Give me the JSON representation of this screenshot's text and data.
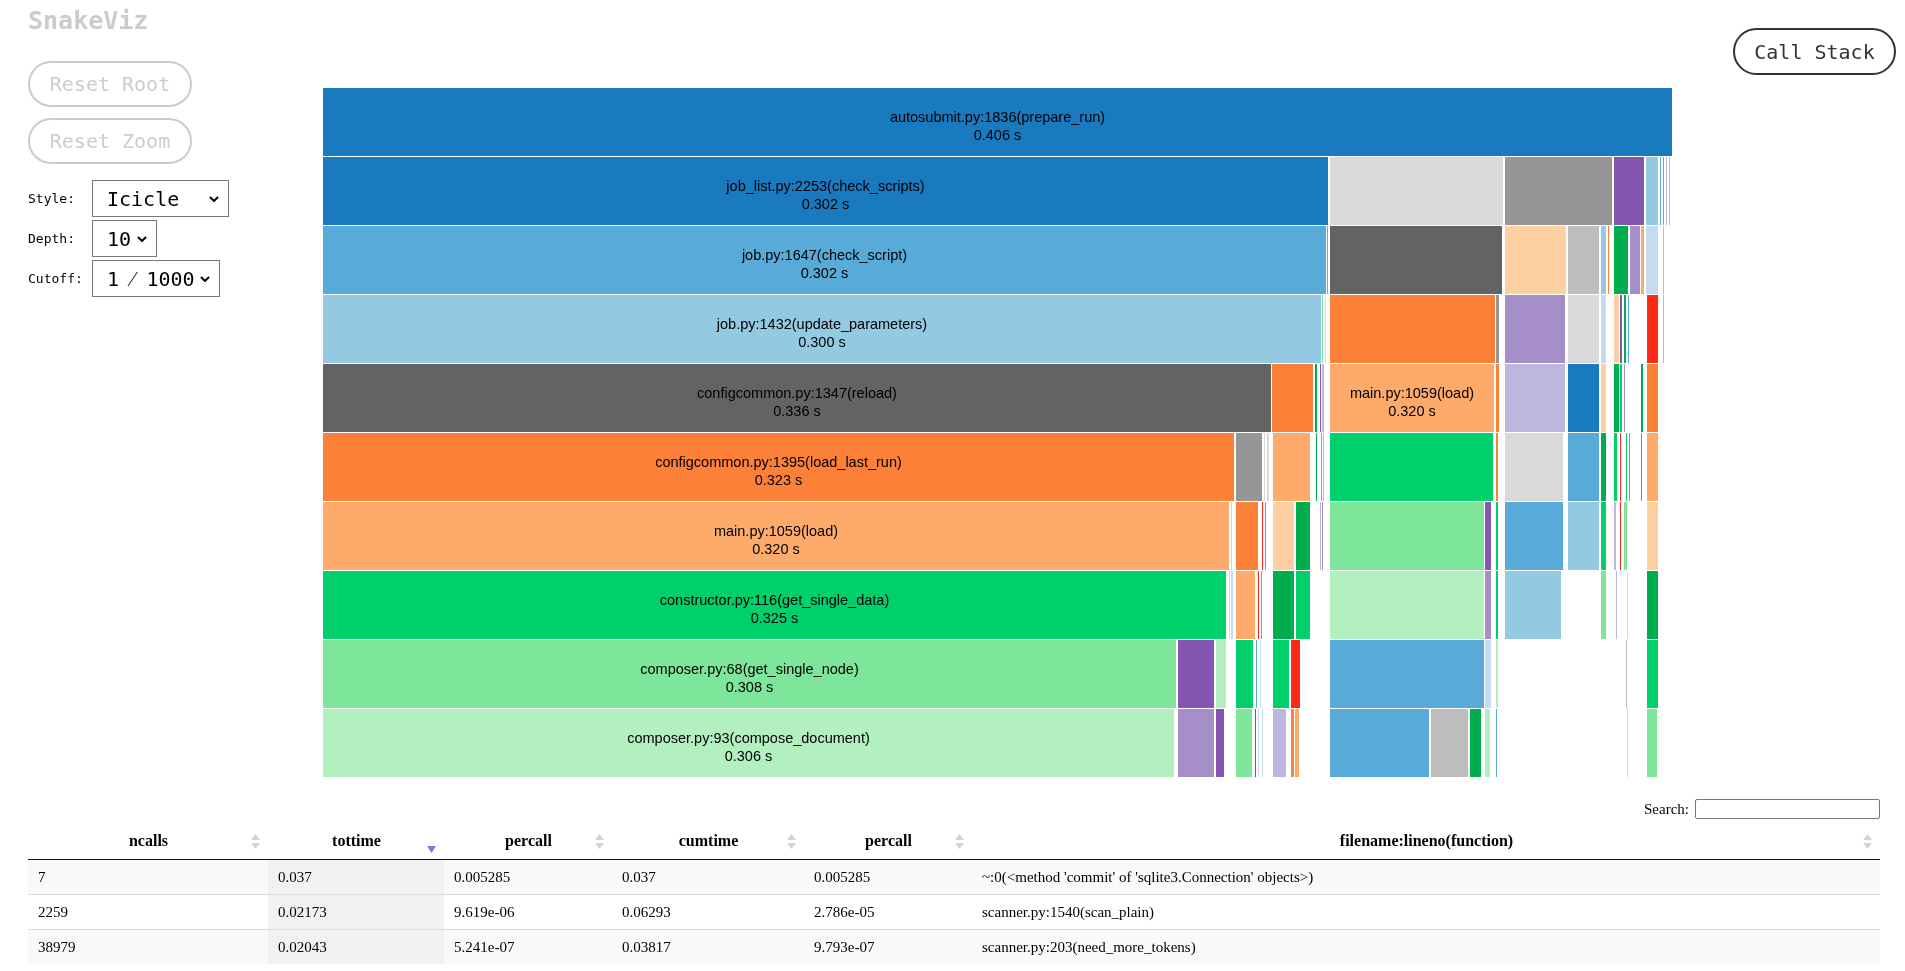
{
  "sidebar": {
    "title": "SnakeViz",
    "buttons": [
      {
        "label": "Reset Root",
        "disabled": true
      },
      {
        "label": "Reset Zoom",
        "disabled": true
      }
    ],
    "options": [
      {
        "label": "Style:",
        "value": "Icicle"
      },
      {
        "label": "Depth:",
        "value": "10"
      },
      {
        "label": "Cutoff:",
        "value": "1 ⁄ 1000"
      }
    ]
  },
  "call_stack_button": {
    "label": "Call Stack",
    "disabled": false
  },
  "icicle": {
    "rows": [
      {
        "blocks": [
          {
            "label": "autosubmit.py:1836(prepare_run)",
            "time": "0.406 s",
            "color": "#1a7abf"
          }
        ]
      },
      {
        "blocks": [
          {
            "label": "job_list.py:2253(check_scripts)",
            "time": "0.302 s",
            "color": "#1a7abf"
          },
          {
            "color": "#d9d9d9"
          },
          {
            "color": "#969696"
          },
          {
            "color": "#8456b2"
          },
          {
            "color": "#93c9e1"
          },
          {
            "color": "#58aad8"
          },
          {
            "color": "#a68fc9"
          },
          {
            "color": "#bfb6dd"
          },
          {
            "color": "#bfb6dd"
          }
        ]
      },
      {
        "blocks": [
          {
            "label": "job.py:1647(check_script)",
            "time": "0.302 s",
            "color": "#58aad8"
          },
          {
            "color": "#fd8039"
          },
          {
            "color": "#636363"
          },
          {
            "color": "#fdd0a2"
          },
          {
            "color": "#bdbdbd"
          },
          {
            "color": "#93c9e1"
          },
          {
            "color": "#fd8039"
          },
          {
            "color": "#00ad4e"
          },
          {
            "color": "#a68fc9"
          },
          {
            "color": "#fdaa6a"
          },
          {
            "color": "#c6dbef"
          },
          {
            "color": "#bfb6dd"
          }
        ]
      },
      {
        "blocks": [
          {
            "label": "job.py:1432(update_parameters)",
            "time": "0.300 s",
            "color": "#93c9e1"
          },
          {
            "color": "#7de69a"
          },
          {
            "color": "#b3f0c0"
          },
          {
            "color": "#fd8039"
          },
          {
            "color": "#969696"
          },
          {
            "color": "#a68fc9"
          },
          {
            "color": "#d9d9d9"
          },
          {
            "color": "#c6dbef"
          },
          {
            "color": "#fdd0a2"
          },
          {
            "color": "#8456b2"
          },
          {
            "color": "#00ad4e"
          },
          {
            "color": "#58aad8"
          },
          {
            "color": "#fb2a16"
          },
          {
            "color": "#bfb6dd"
          }
        ]
      },
      {
        "blocks": [
          {
            "label": "configcommon.py:1347(reload)",
            "time": "0.336 s",
            "color": "#636363"
          },
          {
            "color": "#fd8039"
          },
          {
            "color": "#00ad4e"
          },
          {
            "color": "#8456b2"
          },
          {
            "color": "#bfb6dd"
          },
          {
            "label": "main.py:1059(load)",
            "time": "0.320 s",
            "color": "#fdaa6a"
          },
          {
            "color": "#fd8039"
          },
          {
            "color": "#bfb6dd"
          },
          {
            "color": "#1a7abf"
          },
          {
            "color": "#fdd0a2"
          },
          {
            "color": "#00ad4e"
          },
          {
            "color": "#00d06c"
          },
          {
            "color": "#a68fc9"
          },
          {
            "color": "#00ad4e"
          },
          {
            "color": "#fd8039"
          }
        ]
      },
      {
        "blocks": [
          {
            "label": "configcommon.py:1395(load_last_run)",
            "time": "0.323 s",
            "color": "#fd8039"
          },
          {
            "color": "#969696"
          },
          {
            "color": "#d9d9d9"
          },
          {
            "color": "#d9d9d9"
          },
          {
            "color": "#fdaa6a"
          },
          {
            "color": "#00ad4e"
          },
          {
            "color": "#a68fc9"
          },
          {
            "color": "#bfb6dd"
          },
          {
            "color": "#00d06c"
          },
          {
            "color": "#fd8039"
          },
          {
            "color": "#d9d9d9"
          },
          {
            "color": "#58aad8"
          },
          {
            "color": "#00ad4e"
          },
          {
            "color": "#00d06c"
          },
          {
            "color": "#fb2a16"
          },
          {
            "color": "#00d06c"
          },
          {
            "color": "#58aad8"
          },
          {
            "color": "#00d06c"
          },
          {
            "color": "#fdaa6a"
          }
        ]
      },
      {
        "blocks": [
          {
            "label": "main.py:1059(load)",
            "time": "0.320 s",
            "color": "#fdaa6a"
          },
          {
            "color": "#c6dbef"
          },
          {
            "color": "#fd8039"
          },
          {
            "color": "#fb2a16"
          },
          {
            "color": "#58aad8"
          },
          {
            "color": "#fdd0a2"
          },
          {
            "color": "#00ad4e"
          },
          {
            "color": "#bfb6dd"
          },
          {
            "color": "#a68fc9"
          },
          {
            "color": "#7de69a"
          },
          {
            "color": "#8456b2"
          },
          {
            "color": "#00d06c"
          },
          {
            "color": "#58aad8"
          },
          {
            "color": "#93c9e1"
          },
          {
            "color": "#00d06c"
          },
          {
            "color": "#bfb6dd"
          },
          {
            "color": "#fb2a16"
          },
          {
            "color": "#7de69a"
          },
          {
            "color": "#fdd0a2"
          }
        ]
      },
      {
        "blocks": [
          {
            "label": "constructor.py:116(get_single_data)",
            "time": "0.325 s",
            "color": "#00d06c"
          },
          {
            "color": "#d9d9d9"
          },
          {
            "color": "#c6dbef"
          },
          {
            "color": "#fdaa6a"
          },
          {
            "color": "#fb2a16"
          },
          {
            "color": "#58aad8"
          },
          {
            "color": "#00ad4e"
          },
          {
            "color": "#00d06c"
          },
          {
            "color": "#b3f0c0"
          },
          {
            "color": "#a68fc9"
          },
          {
            "color": "#00d06c"
          },
          {
            "color": "#93c9e1"
          },
          {
            "color": "#7de69a"
          },
          {
            "color": "#bfb6dd"
          },
          {
            "color": "#d9d9d9"
          },
          {
            "color": "#00ad4e"
          }
        ]
      },
      {
        "blocks": [
          {
            "label": "composer.py:68(get_single_node)",
            "time": "0.308 s",
            "color": "#7de69a"
          },
          {
            "color": "#8456b2"
          },
          {
            "color": "#b3f0c0"
          },
          {
            "color": "#00d06c"
          },
          {
            "color": "#58aad8"
          },
          {
            "color": "#c6dbef"
          },
          {
            "color": "#00d06c"
          },
          {
            "color": "#fb2a16"
          },
          {
            "color": "#58aad8"
          },
          {
            "color": "#c6dbef"
          },
          {
            "color": "#b3f0c0"
          },
          {
            "color": "#bdbdbd"
          },
          {
            "color": "#00d06c"
          }
        ]
      },
      {
        "blocks": [
          {
            "label": "composer.py:93(compose_document)",
            "time": "0.306 s",
            "color": "#b3f0c0"
          },
          {
            "color": "#a68fc9"
          },
          {
            "color": "#8456b2"
          },
          {
            "color": "#7de69a"
          },
          {
            "color": "#636363"
          },
          {
            "color": "#c6dbef"
          },
          {
            "color": "#c6dbef"
          },
          {
            "color": "#bfb6dd"
          },
          {
            "color": "#fd8039"
          },
          {
            "color": "#fdaa6a"
          },
          {
            "color": "#58aad8"
          },
          {
            "color": "#bdbdbd"
          },
          {
            "color": "#00ad4e"
          },
          {
            "color": "#b3f0c0"
          },
          {
            "color": "#58aad8"
          },
          {
            "color": "#d9d9d9"
          },
          {
            "color": "#7de69a"
          }
        ]
      }
    ]
  },
  "table": {
    "search": {
      "label": "Search:"
    },
    "columns": [
      {
        "label": "ncalls",
        "sorted": false
      },
      {
        "label": "tottime",
        "sorted": true
      },
      {
        "label": "percall",
        "sorted": false
      },
      {
        "label": "cumtime",
        "sorted": false
      },
      {
        "label": "percall",
        "sorted": false
      },
      {
        "label": "filename:lineno(function)",
        "sorted": false
      }
    ],
    "rows": [
      [
        "7",
        "0.037",
        "0.005285",
        "0.037",
        "0.005285",
        "~:0(<method 'commit' of 'sqlite3.Connection' objects>)"
      ],
      [
        "2259",
        "0.02173",
        "9.619e-06",
        "0.06293",
        "2.786e-05",
        "scanner.py:1540(scan_plain)"
      ],
      [
        "38979",
        "0.02043",
        "5.241e-07",
        "0.03817",
        "9.793e-07",
        "scanner.py:203(need_more_tokens)"
      ]
    ]
  }
}
